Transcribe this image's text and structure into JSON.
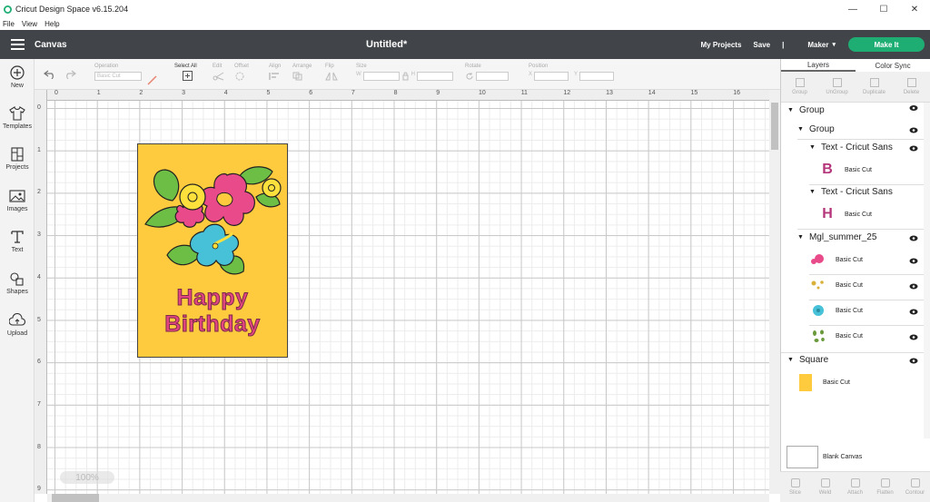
{
  "window": {
    "title": "Cricut Design Space  v6.15.204",
    "minimize": "—",
    "maximize": "☐",
    "close": "✕"
  },
  "menu": [
    "File",
    "View",
    "Help"
  ],
  "header": {
    "section": "Canvas",
    "doc_title": "Untitled*",
    "my_projects": "My Projects",
    "save": "Save",
    "separator": "|",
    "machine": "Maker",
    "make_it": "Make It"
  },
  "leftnav": [
    {
      "label": "New",
      "icon": "plus-circle-icon"
    },
    {
      "label": "Templates",
      "icon": "shirt-icon"
    },
    {
      "label": "Projects",
      "icon": "projects-icon"
    },
    {
      "label": "Images",
      "icon": "image-icon"
    },
    {
      "label": "Text",
      "icon": "text-icon"
    },
    {
      "label": "Shapes",
      "icon": "shapes-icon"
    },
    {
      "label": "Upload",
      "icon": "upload-icon"
    }
  ],
  "toolbar": {
    "operation_label": "Operation",
    "operation_value": "Basic Cut",
    "select_all": "Select All",
    "edit": "Edit",
    "offset": "Offset",
    "align": "Align",
    "arrange": "Arrange",
    "flip": "Flip",
    "size": "Size",
    "w": "W",
    "h": "H",
    "rotate": "Rotate",
    "position": "Position",
    "x": "X",
    "y": "Y"
  },
  "ruler_top": [
    "0",
    "1",
    "2",
    "3",
    "4",
    "5",
    "6",
    "7",
    "8",
    "9",
    "10",
    "11",
    "12",
    "13",
    "14",
    "15",
    "16"
  ],
  "ruler_left": [
    "0",
    "1",
    "2",
    "3",
    "4",
    "5",
    "6",
    "7",
    "8",
    "9"
  ],
  "zoom": "100%",
  "card": {
    "line1": "Happy",
    "line2": "Birthday",
    "bg": "#fecb3e",
    "text_color": "#e2457f"
  },
  "right_panel": {
    "tabs": [
      "Layers",
      "Color Sync"
    ],
    "actions": [
      "Group",
      "UnGroup",
      "Duplicate",
      "Delete"
    ],
    "layers": {
      "group_root": "Group",
      "group_inner": "Group",
      "text1": "Text - Cricut Sans",
      "text1_letter": "B",
      "text1_op": "Basic Cut",
      "text2": "Text - Cricut Sans",
      "text2_letter": "H",
      "text2_op": "Basic Cut",
      "mgl": "Mgl_summer_25",
      "mgl_ops": [
        "Basic Cut",
        "Basic Cut",
        "Basic Cut",
        "Basic Cut"
      ],
      "square": "Square",
      "square_op": "Basic Cut"
    },
    "blank_canvas": "Blank Canvas",
    "bottom_actions": [
      "Slice",
      "Weld",
      "Attach",
      "Flatten",
      "Contour"
    ]
  }
}
